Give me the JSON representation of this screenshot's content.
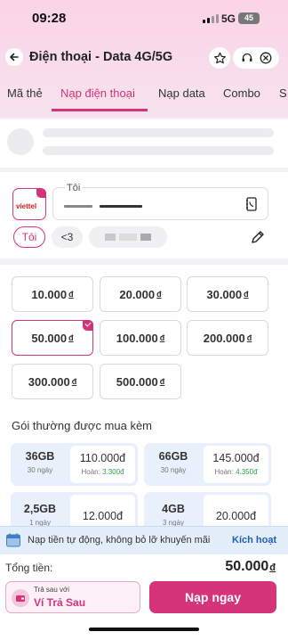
{
  "status_bar": {
    "time": "09:28",
    "network": "5G",
    "battery": "45"
  },
  "header": {
    "title": "Điện thoại - Data 4G/5G"
  },
  "tabs": [
    {
      "label": "Mã thẻ"
    },
    {
      "label": "Nạp điện thoại",
      "active": true
    },
    {
      "label": "Nạp data"
    },
    {
      "label": "Combo"
    },
    {
      "label": "S"
    }
  ],
  "recipient": {
    "carrier_logo_text": "viettel",
    "field_label": "Tôi",
    "chip_self": "Tôi",
    "chip_other": "<3"
  },
  "amounts": [
    {
      "value": "10.000",
      "unit": "đ"
    },
    {
      "value": "20.000",
      "unit": "đ"
    },
    {
      "value": "30.000",
      "unit": "đ"
    },
    {
      "value": "50.000",
      "unit": "đ",
      "selected": true
    },
    {
      "value": "100.000",
      "unit": "đ"
    },
    {
      "value": "200.000",
      "unit": "đ"
    },
    {
      "value": "300.000",
      "unit": "đ"
    },
    {
      "value": "500.000",
      "unit": "đ"
    }
  ],
  "packages_title": "Gói thường được mua kèm",
  "packages": [
    {
      "data": "36GB",
      "days": "30 ngày",
      "price": "110.000đ",
      "cashback_label": "Hoàn:",
      "cashback": "3.300đ"
    },
    {
      "data": "66GB",
      "days": "30 ngày",
      "price": "145.000đ",
      "cashback_label": "Hoàn:",
      "cashback": "4.350đ"
    },
    {
      "data": "2,5GB",
      "days": "1 ngày",
      "price": "12.000đ"
    },
    {
      "data": "4GB",
      "days": "3 ngày",
      "price": "20.000đ"
    }
  ],
  "promo": {
    "text": "Nạp tiền tự động, không bỏ lỡ khuyến mãi",
    "action": "Kích hoạt"
  },
  "footer": {
    "total_label": "Tổng tiền:",
    "total_value": "50.000",
    "total_unit": "đ",
    "wallet_caption": "Trả sau với",
    "wallet_name": "Ví Trả Sau",
    "pay_button": "Nạp ngay"
  },
  "colors": {
    "accent": "#d5337a",
    "cashback": "#2fa34a",
    "promo_bg": "#e4eefb"
  }
}
